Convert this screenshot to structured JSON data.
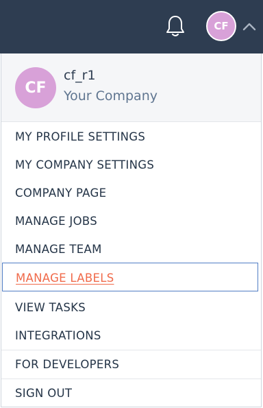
{
  "header": {
    "avatar_initials": "CF"
  },
  "user": {
    "initials": "CF",
    "name": "cf_r1",
    "company": "Your Company"
  },
  "menu": {
    "items": [
      {
        "label": "MY PROFILE SETTINGS"
      },
      {
        "label": "MY COMPANY SETTINGS"
      },
      {
        "label": "COMPANY PAGE"
      },
      {
        "label": "MANAGE JOBS"
      },
      {
        "label": "MANAGE TEAM"
      },
      {
        "label": "MANAGE LABELS",
        "active": true
      },
      {
        "label": "VIEW TASKS"
      },
      {
        "label": "INTEGRATIONS"
      },
      {
        "label": "FOR DEVELOPERS"
      },
      {
        "label": "SIGN OUT"
      }
    ]
  },
  "colors": {
    "topbar": "#2e3d51",
    "avatar": "#d8a1d8",
    "active_text": "#f06a4a",
    "focus_border": "#4f7cc4"
  },
  "icons": [
    "bell-icon",
    "chevron-up-icon"
  ]
}
